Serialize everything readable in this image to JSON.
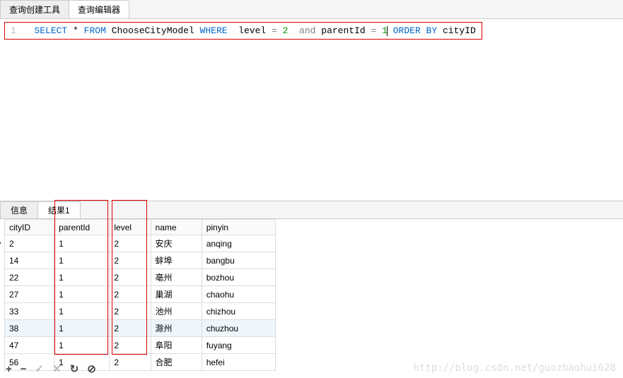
{
  "top_tabs": {
    "build_tool": "查询创建工具",
    "editor": "查询编辑器"
  },
  "sql": {
    "line": "1",
    "select": "SELECT",
    "star": "*",
    "from": "FROM",
    "table": "ChooseCityModel",
    "where": "WHERE",
    "cond1_field": "level",
    "eq1": "=",
    "cond1_val": "2",
    "and": "and",
    "cond2_field": "parentId",
    "eq2": "=",
    "cond2_val": "1",
    "orderby": "ORDER BY",
    "order_field": "cityID"
  },
  "bottom_tabs": {
    "info": "信息",
    "result1": "结果1"
  },
  "columns": {
    "cityID": "cityID",
    "parentId": "parentId",
    "level": "level",
    "name": "name",
    "pinyin": "pinyin"
  },
  "rows": [
    {
      "cityID": "2",
      "parentId": "1",
      "level": "2",
      "name": "安庆",
      "pinyin": "anqing"
    },
    {
      "cityID": "14",
      "parentId": "1",
      "level": "2",
      "name": "蚌埠",
      "pinyin": "bangbu"
    },
    {
      "cityID": "22",
      "parentId": "1",
      "level": "2",
      "name": "亳州",
      "pinyin": "bozhou"
    },
    {
      "cityID": "27",
      "parentId": "1",
      "level": "2",
      "name": "巢湖",
      "pinyin": "chaohu"
    },
    {
      "cityID": "33",
      "parentId": "1",
      "level": "2",
      "name": "池州",
      "pinyin": "chizhou"
    },
    {
      "cityID": "38",
      "parentId": "1",
      "level": "2",
      "name": "滁州",
      "pinyin": "chuzhou"
    },
    {
      "cityID": "47",
      "parentId": "1",
      "level": "2",
      "name": "阜阳",
      "pinyin": "fuyang"
    },
    {
      "cityID": "56",
      "parentId": "1",
      "level": "2",
      "name": "合肥",
      "pinyin": "hefei"
    }
  ],
  "toolbar": {
    "add": "+",
    "remove": "−",
    "check": "✓",
    "cancel": "✕",
    "refresh": "↻",
    "stop": "⊘"
  },
  "watermark": "http://blog.csdn.net/guozhaohui628"
}
